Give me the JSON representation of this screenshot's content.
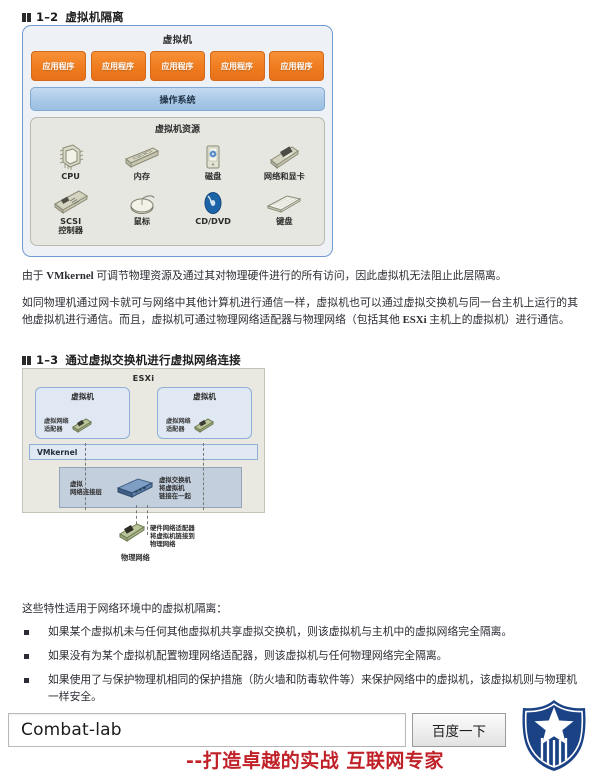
{
  "figure_1_2": {
    "caption_num": "1–2",
    "caption_title": "虚拟机隔离",
    "diagram_title": "虚拟机",
    "apps": [
      "应用程序",
      "应用程序",
      "应用程序",
      "应用程序",
      "应用程序"
    ],
    "os_label": "操作系统",
    "resources_title": "虚拟机资源",
    "resources": [
      {
        "icon": "cpu-icon",
        "label": "CPU"
      },
      {
        "icon": "memory-icon",
        "label": "内存"
      },
      {
        "icon": "disk-icon",
        "label": "磁盘"
      },
      {
        "icon": "network-video-card-icon",
        "label": "网络和显卡"
      },
      {
        "icon": "scsi-controller-icon",
        "label": "SCSI\n控制器"
      },
      {
        "icon": "mouse-icon",
        "label": "鼠标"
      },
      {
        "icon": "cddvd-icon",
        "label": "CD/DVD"
      },
      {
        "icon": "keyboard-icon",
        "label": "键盘"
      }
    ],
    "colors": {
      "app_box": "#ef7c1e",
      "os_box": "#a9c8e6",
      "frame_border": "#6f9bd1",
      "resource_panel": "#e7e7e1"
    }
  },
  "paragraphs": {
    "p1_prefix": "由于 ",
    "p1_bold": "VMkernel",
    "p1_rest": " 可调节物理资源及通过其对物理硬件进行的所有访问，因此虚拟机无法阻止此层隔离。",
    "p2_a": "如同物理机通过网卡就可与网络中其他计算机进行通信一样，虚拟机也可以通过虚拟交换机与同一台主机上运行的其他虚拟机进行通信。而且，虚拟机可通过物理网络适配器与物理网络（包括其他 ",
    "p2_bold": "ESXi",
    "p2_b": " 主机上的虚拟机）进行通信。"
  },
  "figure_1_3": {
    "caption_num": "1–3",
    "caption_title": "通过虚拟交换机进行虚拟网络连接",
    "esxi_label": "ESXi",
    "vm_cards": [
      {
        "title": "虚拟机",
        "adapter_label": "虚拟网络\n适配器"
      },
      {
        "title": "虚拟机",
        "adapter_label": "虚拟网络\n适配器"
      }
    ],
    "vmkernel_label": "VMkernel",
    "vnet_layer_label": "虚拟\n网络连接层",
    "vswitch_label": "虚拟交换机\n将虚拟机\n链接在一起",
    "phys_adapter_label": "硬件网络适配器\n将虚拟机链接到\n物理网络",
    "phys_network_label": "物理网络"
  },
  "list": {
    "intro": "这些特性适用于网络环境中的虚拟机隔离：",
    "items": [
      "如果某个虚拟机未与任何其他虚拟机共享虚拟交换机，则该虚拟机与主机中的虚拟网络完全隔离。",
      "如果没有为某个虚拟机配置物理网络适配器，则该虚拟机与任何物理网络完全隔离。",
      "如果使用了与保护物理机相同的保护措施（防火墙和防毒软件等）来保护网络中的虚拟机，该虚拟机则与物理机一样安全。"
    ]
  },
  "bottom_bar": {
    "search_value": "Combat-lab",
    "search_button_label": "百度一下",
    "tagline": "--打造卓越的实战 互联网专家",
    "logo_name": "shield-star-logo",
    "logo_color": "#1c4286",
    "tagline_color": "#c02128"
  }
}
